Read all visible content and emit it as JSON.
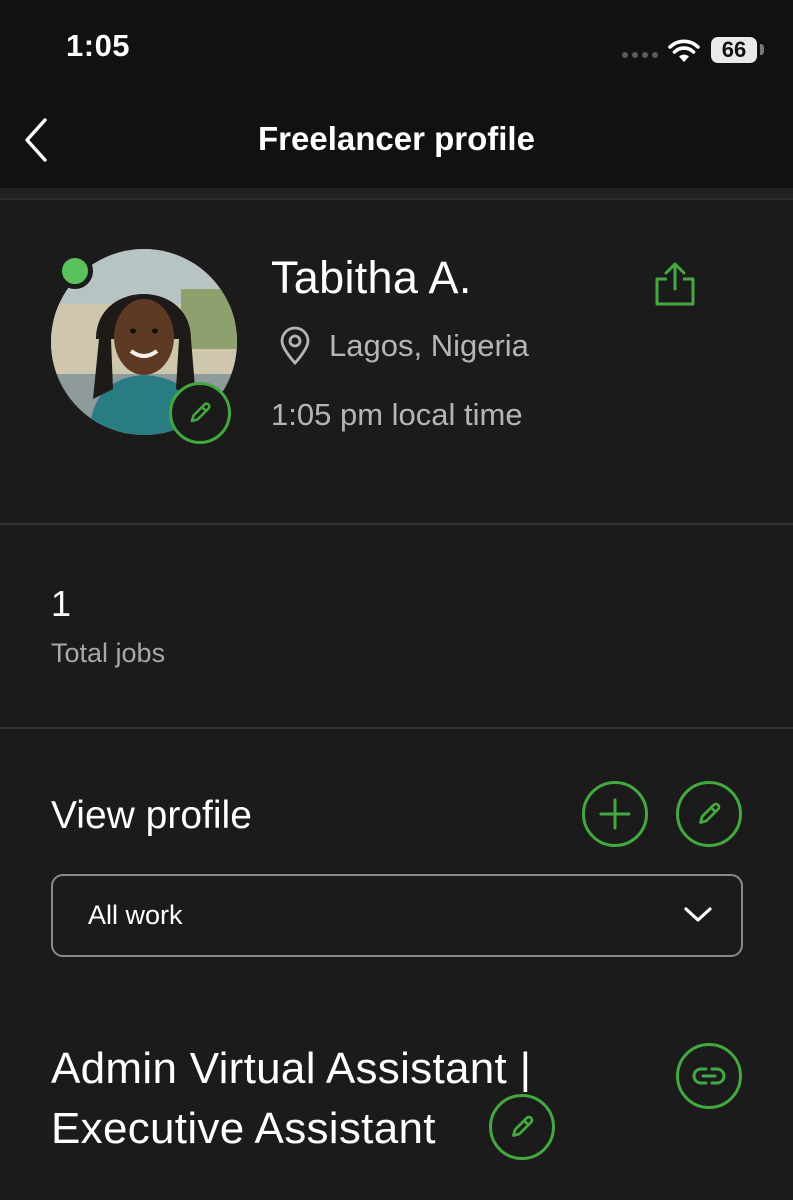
{
  "status_bar": {
    "time": "1:05",
    "battery": "66"
  },
  "nav": {
    "title": "Freelancer profile"
  },
  "profile": {
    "name": "Tabitha A.",
    "location": "Lagos, Nigeria",
    "local_time": "1:05 pm local time",
    "online": true
  },
  "stats": {
    "total_jobs": "1",
    "total_jobs_label": "Total jobs"
  },
  "work": {
    "section_title": "View profile",
    "filter": {
      "selected": "All work"
    },
    "job_title_line1": "Admin Virtual Assistant |",
    "job_title_line2": "Executive Assistant"
  },
  "colors": {
    "background": "#1b1b1b",
    "header": "#111111",
    "accent_green": "#43a83f",
    "online_dot": "#59c25b",
    "secondary_text": "#b5b5b5"
  },
  "icons": [
    "back-chevron-icon",
    "share-icon",
    "location-pin-icon",
    "pencil-icon",
    "plus-icon",
    "chevron-down-icon",
    "link-icon",
    "wifi-icon",
    "battery-icon"
  ]
}
